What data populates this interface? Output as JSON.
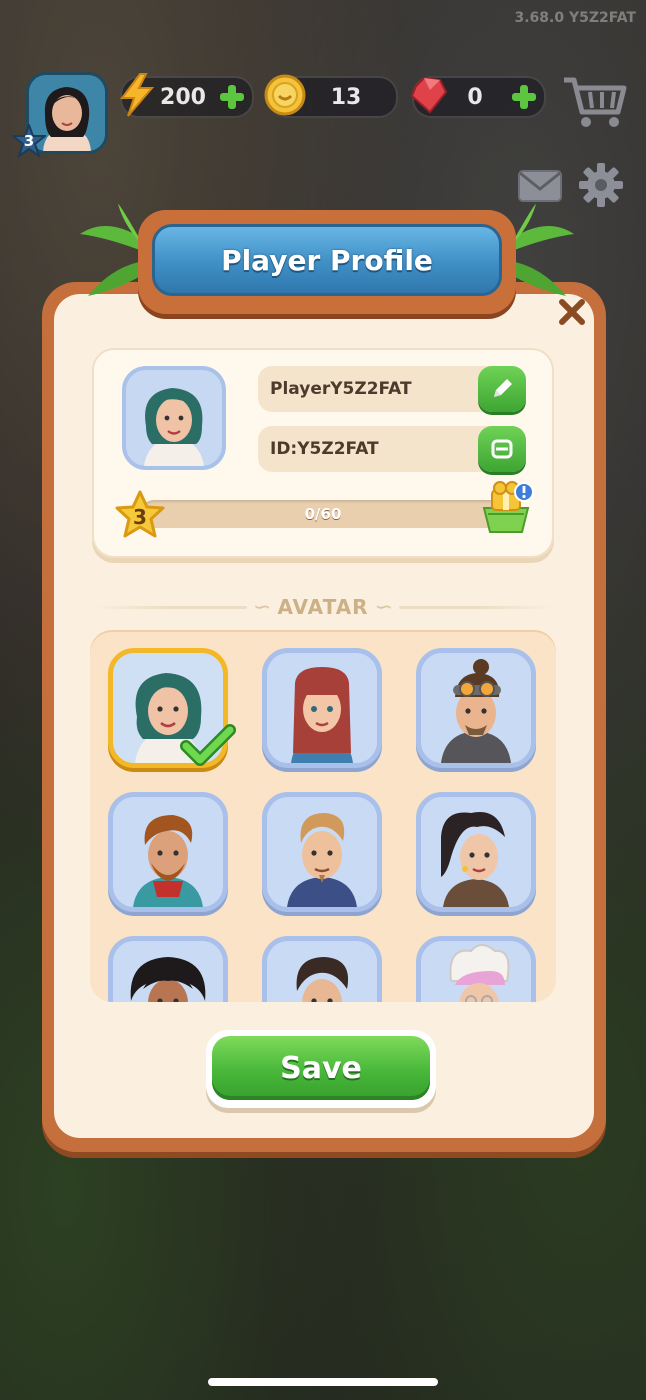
{
  "version": "3.68.0 Y5Z2FAT",
  "hud": {
    "level": "3",
    "energy": "200",
    "coins": "13",
    "gems": "0"
  },
  "panel": {
    "title": "Player Profile",
    "name": "PlayerY5Z2FAT",
    "id": "ID:Y5Z2FAT",
    "level": "3",
    "xp_text": "0/60",
    "xp_progress": 0,
    "section_title": "AVATAR",
    "save_label": "Save"
  },
  "colors": {
    "panel_orange": "#c5703c",
    "title_blue": "#3f8fc6",
    "save_green": "#48b73a",
    "selected_gold": "#f3b828"
  }
}
